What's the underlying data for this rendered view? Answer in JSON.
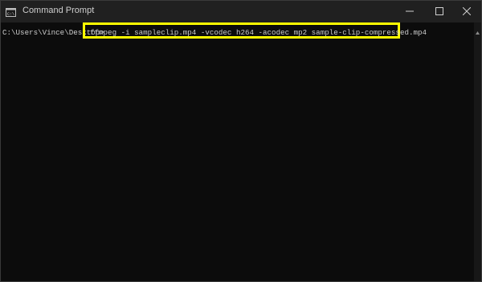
{
  "window": {
    "title": "Command Prompt"
  },
  "console": {
    "prompt": "C:\\Users\\Vince\\Desktop>",
    "command": "ffmpeg -i sampleclip.mp4 -vcodec h264 -acodec mp2 sample-clip-compressed.mp4"
  },
  "colors": {
    "background": "#0c0c0c",
    "text": "#cccccc",
    "highlight": "#ffff00",
    "titlebar": "#202020"
  },
  "icons": {
    "app": "cmd-icon",
    "minimize": "minimize-icon",
    "maximize": "maximize-icon",
    "close": "close-icon",
    "scroll_up": "scroll-up-arrow-icon"
  }
}
